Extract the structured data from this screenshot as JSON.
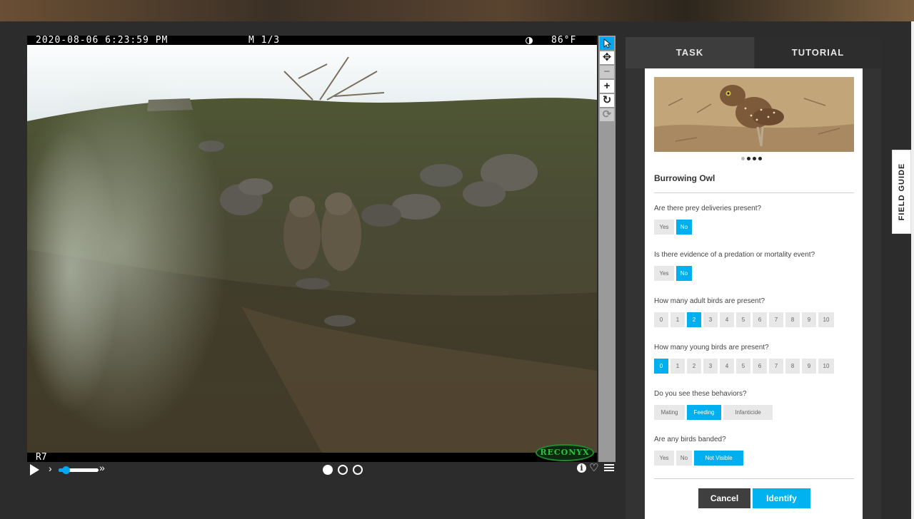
{
  "camera": {
    "timestamp": "2020-08-06  6:23:59 PM",
    "mode": "M 1/3",
    "temperature": "86°F",
    "camera_id": "R7",
    "brand": "RECONYX"
  },
  "toolbar": {
    "icons": [
      "pointer-icon",
      "pan-icon",
      "zoom-out-icon",
      "zoom-in-icon",
      "rotate-icon",
      "reset-icon"
    ]
  },
  "playback": {
    "speed_fraction": 0.18,
    "frames": 3,
    "current_frame": 1
  },
  "tabs": {
    "task": "TASK",
    "tutorial": "TUTORIAL"
  },
  "field_guide": {
    "label": "FIELD GUIDE"
  },
  "species": {
    "name": "Burrowing Owl",
    "image_count": 4,
    "current_image": 1
  },
  "questions": [
    {
      "text": "Are there prey deliveries present?",
      "options": [
        "Yes",
        "No"
      ],
      "selected": [
        1
      ]
    },
    {
      "text": "Is there evidence of a predation or mortality event?",
      "options": [
        "Yes",
        "No"
      ],
      "selected": [
        1
      ]
    },
    {
      "text": "How many adult birds are present?",
      "options": [
        "0",
        "1",
        "2",
        "3",
        "4",
        "5",
        "6",
        "7",
        "8",
        "9",
        "10"
      ],
      "selected": [
        2
      ]
    },
    {
      "text": "How many young birds are present?",
      "options": [
        "0",
        "1",
        "2",
        "3",
        "4",
        "5",
        "6",
        "7",
        "8",
        "9",
        "10"
      ],
      "selected": [
        0
      ]
    },
    {
      "text": "Do you see these behaviors?",
      "options": [
        "Mating",
        "Feeding",
        "Infanticide"
      ],
      "selected": [
        1
      ]
    },
    {
      "text": "Are any birds banded?",
      "options": [
        "Yes",
        "No",
        "Not Visible"
      ],
      "selected": [
        2
      ]
    }
  ],
  "actions": {
    "cancel": "Cancel",
    "identify": "Identify"
  },
  "colors": {
    "accent": "#00aff0",
    "panel_bg": "#333333",
    "selected_option": "#00aff0"
  }
}
